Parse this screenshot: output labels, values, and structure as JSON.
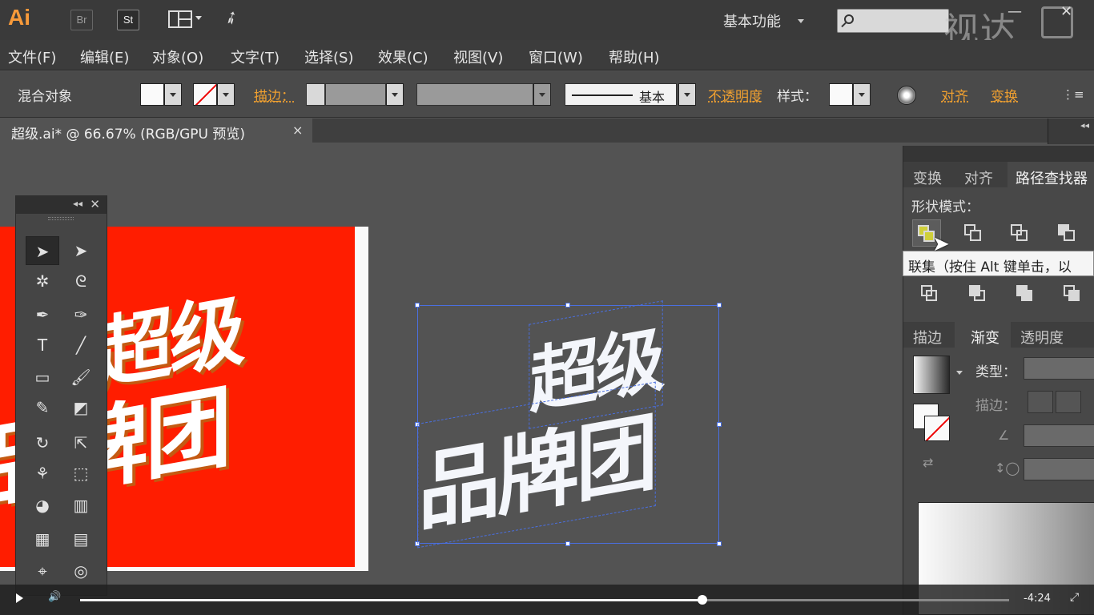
{
  "app": {
    "logo": "Ai",
    "bridge": "Br",
    "stock": "St",
    "workspace": "基本功能",
    "watermark": "视达"
  },
  "menu": [
    "文件(F)",
    "编辑(E)",
    "对象(O)",
    "文字(T)",
    "选择(S)",
    "效果(C)",
    "视图(V)",
    "窗口(W)",
    "帮助(H)"
  ],
  "control": {
    "selection_type": "混合对象",
    "stroke_label": "描边：",
    "stroke_profile": "基本",
    "opacity_label": "不透明度",
    "style_label": "样式：",
    "align_label": "对齐",
    "transform_label": "变换"
  },
  "document": {
    "tab_title": "超级.ai* @ 66.67% (RGB/GPU 预览)",
    "close": "×"
  },
  "artwork": {
    "line1": "超级",
    "line2": "品牌团"
  },
  "panels": {
    "tabs_top": [
      "变换",
      "对齐",
      "路径查找器"
    ],
    "shape_modes": "形状模式：",
    "tooltip": "联集（按住 Alt 键单击，以",
    "tabs_bottom": [
      "描边",
      "渐变",
      "透明度"
    ],
    "type_label": "类型：",
    "stroke_label": "描边："
  },
  "video": {
    "time_remaining": "-4:24",
    "progress": 0.67
  },
  "colors": {
    "artboard_red": "#ff1d00",
    "accent_orange": "#f0a030",
    "selection_blue": "#4a6fe0"
  }
}
